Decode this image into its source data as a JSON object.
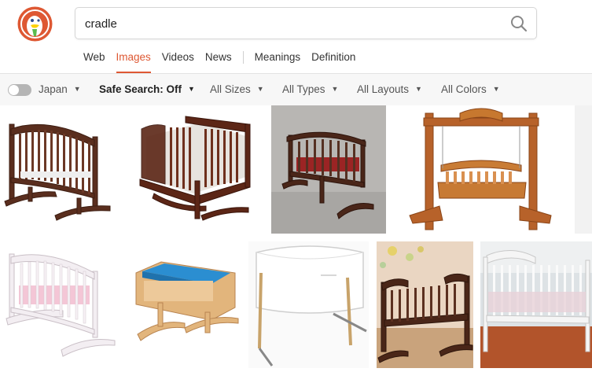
{
  "search": {
    "query": "cradle"
  },
  "tabs": [
    "Web",
    "Images",
    "Videos",
    "News",
    "Meanings",
    "Definition"
  ],
  "active_tab": "Images",
  "filters": {
    "region": "Japan",
    "safe_search": "Safe Search: Off",
    "sizes": "All Sizes",
    "types": "All Types",
    "layouts": "All Layouts",
    "colors": "All Colors"
  },
  "colors": {
    "accent": "#de5833",
    "logo_red": "#de5833",
    "wood_dark": "#5a2e1e",
    "wood_light": "#d9a86c"
  },
  "icons": [
    "duckduckgo-logo-icon",
    "search-icon",
    "caret-down-icon"
  ]
}
